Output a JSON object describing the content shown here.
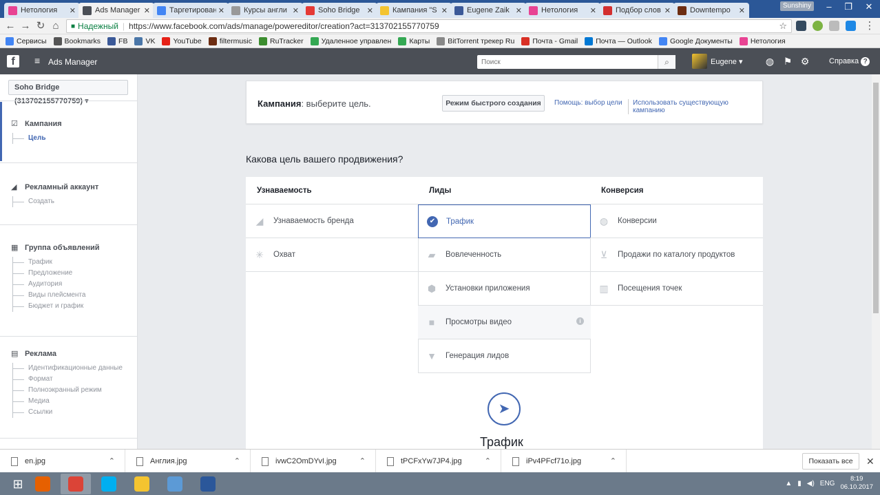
{
  "browser": {
    "tabs": [
      {
        "title": "Нетология",
        "color": "#e84393",
        "active": false
      },
      {
        "title": "Ads Manager",
        "color": "#4b4f56",
        "active": true
      },
      {
        "title": "Таргетирован",
        "color": "#4285f4",
        "active": false
      },
      {
        "title": "Курсы англи",
        "color": "#999999",
        "active": false
      },
      {
        "title": "Soho Bridge",
        "color": "#e53935",
        "active": false
      },
      {
        "title": "Кампания \"S",
        "color": "#f4c430",
        "active": false
      },
      {
        "title": "Eugene Zaik",
        "color": "#3b5998",
        "active": false
      },
      {
        "title": "Нетология",
        "color": "#e84393",
        "active": false
      },
      {
        "title": "Подбор слов",
        "color": "#d32f2f",
        "active": false
      },
      {
        "title": "Downtempo",
        "color": "#6d2d12",
        "active": false
      }
    ],
    "profile": "Sunshiny",
    "secure_label": "Надежный",
    "url": "https://www.facebook.com/ads/manage/powereditor/creation?act=313702155770759",
    "bookmarks": [
      {
        "label": "Сервисы",
        "color": "#4285f4"
      },
      {
        "label": "Bookmarks",
        "color": "#555555"
      },
      {
        "label": "FB",
        "color": "#3b5998"
      },
      {
        "label": "VK",
        "color": "#4a76a8"
      },
      {
        "label": "YouTube",
        "color": "#e62117"
      },
      {
        "label": "filtermusic",
        "color": "#6d2d12"
      },
      {
        "label": "RuTracker",
        "color": "#3c8d2f"
      },
      {
        "label": "Удаленное управлен",
        "color": "#34a853"
      },
      {
        "label": "Карты",
        "color": "#34a853"
      },
      {
        "label": "BitTorrent трекер Ru",
        "color": "#888888"
      },
      {
        "label": "Почта - Gmail",
        "color": "#d93025"
      },
      {
        "label": "Почта — Outlook",
        "color": "#0078d4"
      },
      {
        "label": "Google Документы",
        "color": "#4285f4"
      },
      {
        "label": "Нетология",
        "color": "#e84393"
      }
    ]
  },
  "header": {
    "logo": "f",
    "title": "Ads Manager",
    "search_placeholder": "Поиск",
    "user": "Eugene",
    "help": "Справка"
  },
  "sidebar": {
    "account": "Soho Bridge (313702155770759)",
    "sections": [
      {
        "title": "Кампания",
        "icon": "checkbox-icon",
        "items": [
          "Цель"
        ],
        "active_item": 0
      },
      {
        "title": "Рекламный аккаунт",
        "icon": "megaphone-icon",
        "items": [
          "Создать"
        ],
        "active_item": -1
      },
      {
        "title": "Группа объявлений",
        "icon": "grid-icon",
        "items": [
          "Трафик",
          "Предложение",
          "Аудитория",
          "Виды плейсмента",
          "Бюджет и график"
        ],
        "active_item": -1
      },
      {
        "title": "Реклама",
        "icon": "ad-icon",
        "items": [
          "Идентификационные данные",
          "Формат",
          "Полноэкранный режим",
          "Медиа",
          "Ссылки"
        ],
        "active_item": -1
      }
    ]
  },
  "campaign": {
    "label": "Кампания",
    "hint": ": выберите цель.",
    "quick_mode": "Режим быстрого создания",
    "help_goal": "Помощь: выбор цели",
    "use_existing": "Использовать существующую кампанию"
  },
  "objectives": {
    "question": "Какова цель вашего продвижения?",
    "columns": [
      {
        "title": "Узнаваемость",
        "options": [
          {
            "label": "Узнаваемость бренда",
            "icon": "megaphone-icon"
          },
          {
            "label": "Охват",
            "icon": "snowflake-icon"
          }
        ]
      },
      {
        "title": "Лиды",
        "options": [
          {
            "label": "Трафик",
            "icon": "check-circle-icon",
            "selected": true
          },
          {
            "label": "Вовлеченность",
            "icon": "comments-icon"
          },
          {
            "label": "Установки приложения",
            "icon": "cube-icon"
          },
          {
            "label": "Просмотры видео",
            "icon": "video-camera-icon",
            "info": true
          },
          {
            "label": "Генерация лидов",
            "icon": "funnel-icon"
          }
        ]
      },
      {
        "title": "Конверсия",
        "options": [
          {
            "label": "Конверсии",
            "icon": "globe-icon"
          },
          {
            "label": "Продажи по каталогу продуктов",
            "icon": "cart-icon"
          },
          {
            "label": "Посещения точек",
            "icon": "store-icon"
          }
        ]
      }
    ],
    "detail_title": "Трафик"
  },
  "downloads": {
    "files": [
      "en.jpg",
      "Англия.jpg",
      "ivwC2OmDYvI.jpg",
      "tPCFxYw7JP4.jpg",
      "iPv4PFcf71o.jpg"
    ],
    "show_all": "Показать все"
  },
  "taskbar": {
    "apps": [
      {
        "name": "firefox",
        "color": "#e66000"
      },
      {
        "name": "chrome",
        "color": "#db4437"
      },
      {
        "name": "skype",
        "color": "#00aff0"
      },
      {
        "name": "explorer",
        "color": "#f4c430"
      },
      {
        "name": "control-panel",
        "color": "#5c9ad6"
      },
      {
        "name": "word",
        "color": "#2b579a"
      }
    ],
    "lang": "ENG",
    "time": "8:19",
    "date": "06.10.2017"
  }
}
